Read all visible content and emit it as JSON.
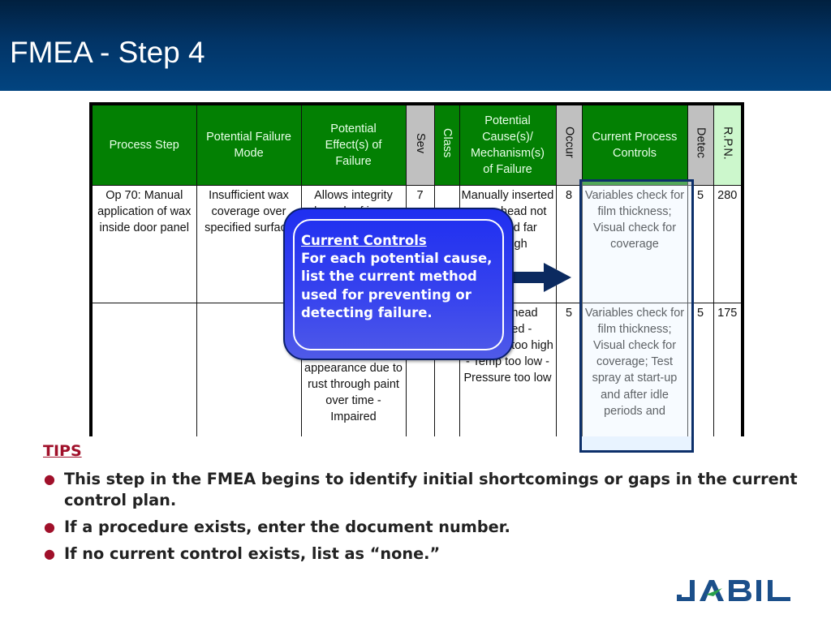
{
  "header": {
    "title": "FMEA - Step 4"
  },
  "table": {
    "columns": [
      {
        "label": "Process Step",
        "style": "green",
        "orientation": "horizontal"
      },
      {
        "label": "Potential Failure Mode",
        "style": "green",
        "orientation": "horizontal"
      },
      {
        "label": "Potential Effect(s) of Failure",
        "style": "green",
        "orientation": "horizontal"
      },
      {
        "label": "Sev",
        "style": "grey",
        "orientation": "vertical"
      },
      {
        "label": "Class",
        "style": "green",
        "orientation": "vertical"
      },
      {
        "label": "Potential Cause(s)/ Mechanism(s) of Failure",
        "style": "green",
        "orientation": "horizontal"
      },
      {
        "label": "Occur",
        "style": "grey",
        "orientation": "vertical"
      },
      {
        "label": "Current Process Controls",
        "style": "green",
        "orientation": "horizontal"
      },
      {
        "label": "Detec",
        "style": "grey",
        "orientation": "vertical"
      },
      {
        "label": "R.P.N.",
        "style": "lightgreen",
        "orientation": "vertical"
      }
    ],
    "rows": [
      {
        "process_step": "Op 70: Manual application of wax inside door panel",
        "failure_mode": "Insufficient wax coverage over specified surface",
        "effects": "Allows integrity breach of inner door panel",
        "sev": "7",
        "class": "",
        "cause": "Manually inserted spray head not inserted far enough",
        "occur": "8",
        "controls": "Variables check for film thickness; Visual check for coverage",
        "detec": "5",
        "rpn": "280"
      },
      {
        "process_step": "",
        "failure_mode": "",
        "effects": "to: - Unsatisfactory appearance due to rust through paint over time - Impaired",
        "sev": "",
        "class": "",
        "cause": "Spray head clogged - Viscosity too high - Temp too low - Pressure too low",
        "occur": "5",
        "controls": "Variables check for film thickness; Visual check for coverage; Test spray at start-up and after idle periods and",
        "detec": "5",
        "rpn": "175"
      }
    ]
  },
  "callout": {
    "title": "Current Controls",
    "body": "For each potential cause, list the current method used for preventing or detecting failure."
  },
  "tips": {
    "title": "TIPS",
    "items": [
      "This step in the FMEA begins to identify initial shortcomings or gaps in the current control plan.",
      "If a procedure exists, enter the document number.",
      "If no current control exists, list as “none.”"
    ]
  },
  "logo": {
    "text": "JABIL",
    "primary_color": "#1b4f8a",
    "accent_color": "#2aa14a"
  },
  "colors": {
    "header_blue": "#023466",
    "header_green": "#038003",
    "header_grey": "#c0c0c0",
    "rpn_green": "#ccf7cc",
    "callout_blue": "#3844ee",
    "tips_red": "#a0102a"
  }
}
